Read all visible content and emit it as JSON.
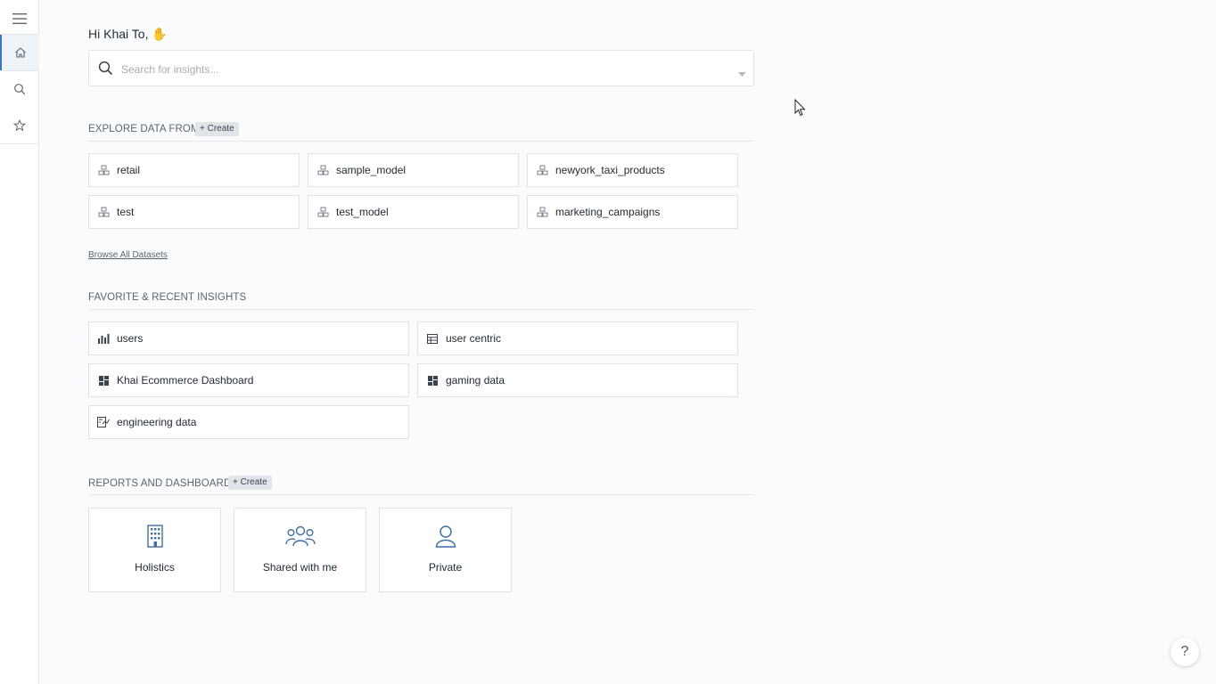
{
  "greeting": {
    "prefix": "Hi ",
    "name": "Khai To,",
    "emoji": "✋"
  },
  "search": {
    "placeholder": "Search for insights..."
  },
  "explore": {
    "title": "EXPLORE DATA FROM",
    "create_label": "+ Create",
    "datasets": [
      "retail",
      "sample_model",
      "newyork_taxi_products",
      "test",
      "test_model",
      "marketing_campaigns"
    ],
    "browse_label": "Browse All Datasets"
  },
  "insights": {
    "title": "FAVORITE & RECENT INSIGHTS",
    "items": [
      {
        "label": "users",
        "icon": "bar-chart-icon"
      },
      {
        "label": "user centric",
        "icon": "table-icon"
      },
      {
        "label": "Khai Ecommerce Dashboard",
        "icon": "dashboard-icon"
      },
      {
        "label": "gaming data",
        "icon": "dashboard-icon"
      },
      {
        "label": "engineering data",
        "icon": "report-icon"
      }
    ]
  },
  "reports": {
    "title": "REPORTS AND DASHBOARDS",
    "create_label": "+ Create",
    "tiles": [
      {
        "label": "Holistics",
        "icon": "building-icon"
      },
      {
        "label": "Shared with me",
        "icon": "group-icon"
      },
      {
        "label": "Private",
        "icon": "person-icon"
      }
    ]
  },
  "help": {
    "label": "?"
  },
  "colors": {
    "accent": "#3b78c2",
    "icon_blue": "#3f6fa8",
    "border": "#dfe3e8"
  }
}
